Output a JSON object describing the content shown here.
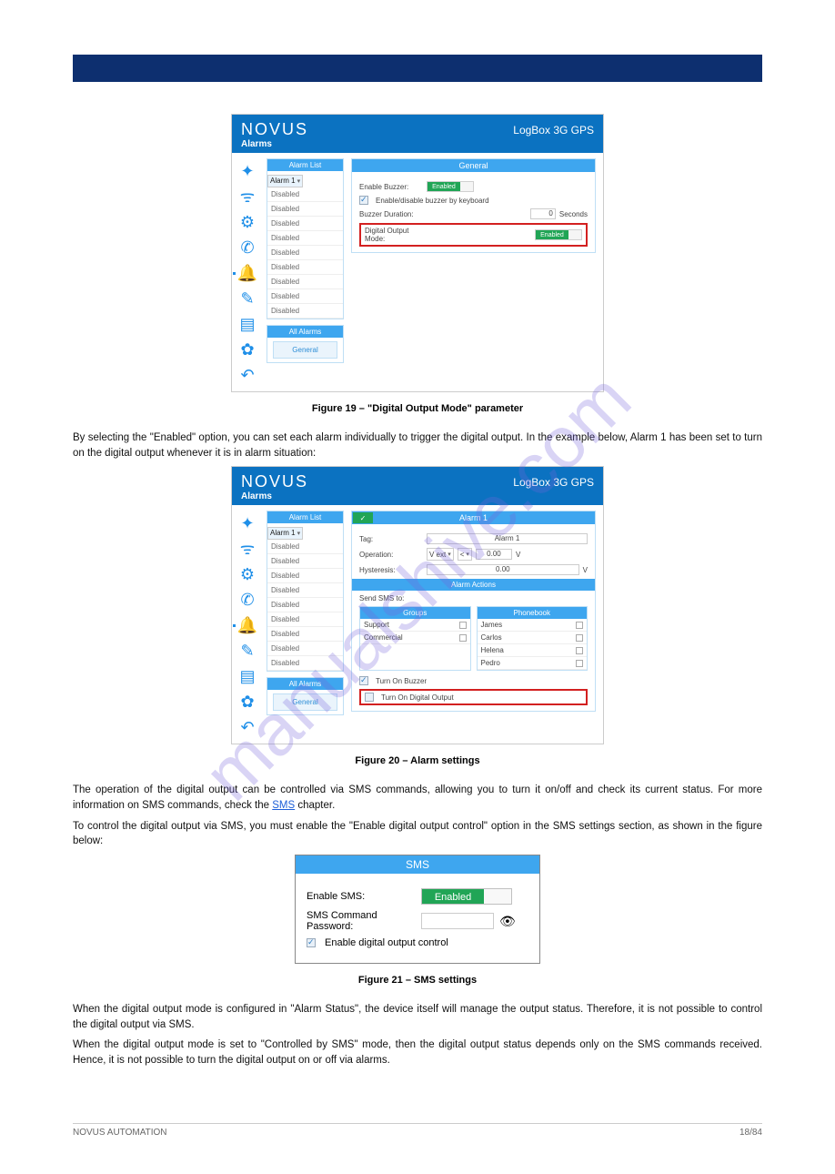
{
  "watermark": "manualshive.com",
  "header": {
    "brand": "NOVUS",
    "model": "LogBox 3G GPS",
    "section": "Alarms"
  },
  "fig1": {
    "list_hd": "Alarm List",
    "alarms": [
      "Alarm 1",
      "Disabled",
      "Disabled",
      "Disabled",
      "Disabled",
      "Disabled",
      "Disabled",
      "Disabled",
      "Disabled",
      "Disabled"
    ],
    "all_hd": "All Alarms",
    "general_btn": "General",
    "main_hd": "General",
    "enable_buzzer_lbl": "Enable Buzzer:",
    "enabled_txt": "Enabled",
    "kb_lbl": "Enable/disable buzzer by keyboard",
    "duration_lbl": "Buzzer Duration:",
    "duration_val": "0",
    "seconds": "Seconds",
    "dom_lbl": "Digital Output Mode:",
    "caption": "Figure 19 – \"Digital Output Mode\" parameter"
  },
  "text1": "By selecting the \"Enabled\" option, you can set each alarm individually to trigger the digital output. In the example below, Alarm 1 has been set to turn on the digital output whenever it is in alarm situation:",
  "fig2": {
    "main_hd": "Alarm 1",
    "tag_lbl": "Tag:",
    "tag_val": "Alarm 1",
    "op_lbl": "Operation:",
    "op_a": "V ext",
    "op_b": "<",
    "op_val": "0.00",
    "unit": "V",
    "hyst_lbl": "Hysteresis:",
    "hyst_val": "0.00",
    "actions_hd": "Alarm Actions",
    "sms_lbl": "Send SMS to:",
    "groups_hd": "Groups",
    "groups": [
      "Support",
      "Commercial"
    ],
    "pb_hd": "Phonebook",
    "contacts": [
      "James",
      "Carlos",
      "Helena",
      "Pedro"
    ],
    "buzzer_chk": "Turn On Buzzer",
    "dout_chk": "Turn On Digital Output",
    "caption": "Figure 20 – Alarm settings"
  },
  "text2a": "The operation of the digital output can be controlled via SMS commands, allowing you to turn it on/off and check its current status. For more information on SMS commands, check the ",
  "text2link": "SMS",
  "text2b": " chapter.",
  "text3": "To control the digital output via SMS, you must enable the \"Enable digital output control\" option in the SMS settings section, as shown in the figure below:",
  "fig3": {
    "hd": "SMS",
    "enable_lbl": "Enable SMS:",
    "enabled": "Enabled",
    "pw_lbl": "SMS Command Password:",
    "ctrl_lbl": "Enable digital output control",
    "caption": "Figure 21 – SMS settings"
  },
  "text4": "When the digital output mode is configured in \"Alarm Status\", the device itself will manage the output status. Therefore, it is not possible to control the digital output via SMS.",
  "text5": "When the digital output mode is set to \"Controlled by SMS\" mode, then the digital output status depends only on the SMS commands received. Hence, it is not possible to turn the digital output on or off via alarms.",
  "footer": {
    "left": "NOVUS AUTOMATION",
    "right": "18/84"
  }
}
